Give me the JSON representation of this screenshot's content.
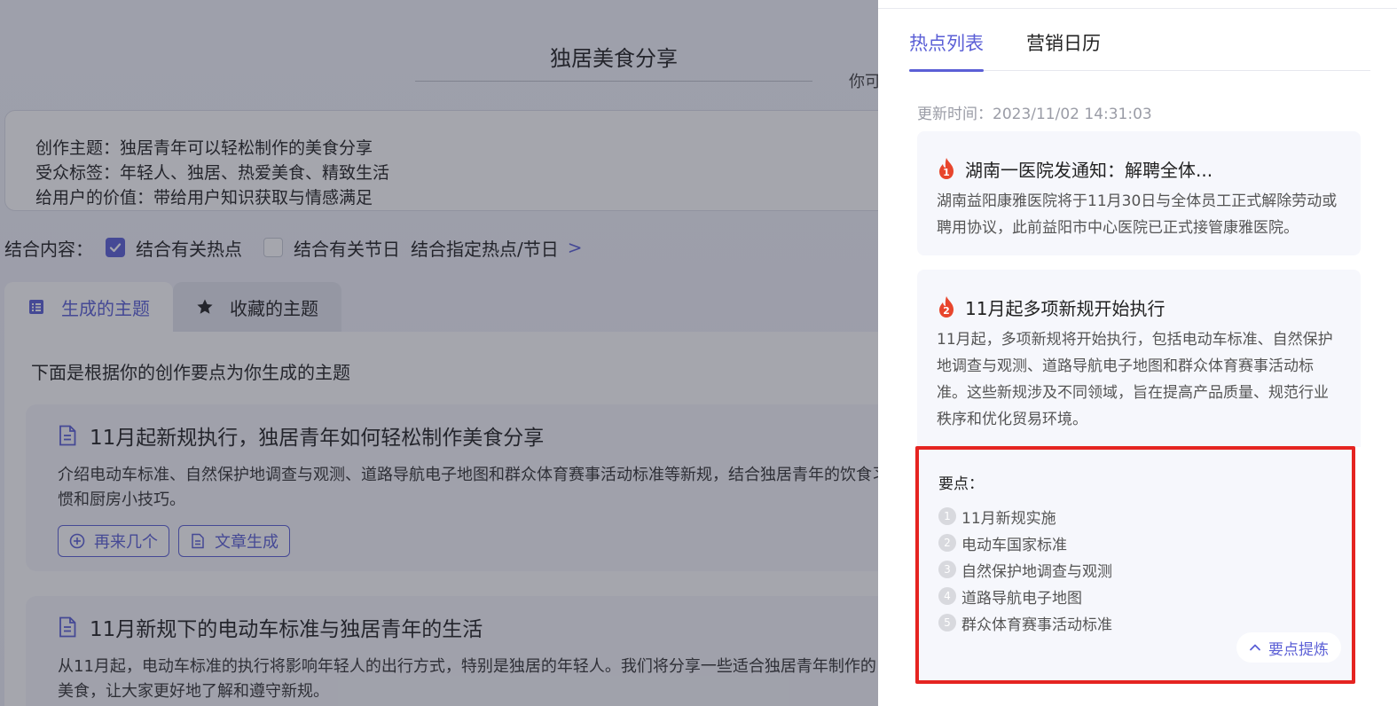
{
  "left": {
    "title_value": "独居美食分享",
    "hint_text": "你可",
    "brief": {
      "theme": "创作主题：独居青年可以轻松制作的美食分享",
      "audience": "受众标签：年轻人、独居、热爱美食、精致生活",
      "value": "给用户的价值：带给用户知识获取与情感满足"
    },
    "combine": {
      "label": "结合内容：",
      "option_hot": "结合有关热点",
      "option_holiday": "结合有关节日",
      "option_specific": "结合指定热点/节日",
      "chevron": ">"
    },
    "tabs": {
      "generated": "生成的主题",
      "favorites": "收藏的主题"
    },
    "intro": "下面是根据你的创作要点为你生成的主题",
    "cards": [
      {
        "title": "11月起新规执行，独居青年如何轻松制作美食分享",
        "desc": "介绍电动车标准、自然保护地调查与观测、道路导航电子地图和群众体育赛事活动标准等新规，结合独居青年的饮食习惯和厨房小技巧。",
        "btn_more": "再来几个",
        "btn_article": "文章生成"
      },
      {
        "title": "11月新规下的电动车标准与独居青年的生活",
        "desc": "从11月起，电动车标准的执行将影响年轻人的出行方式，特别是独居的年轻人。我们将分享一些适合独居青年制作的美食，让大家更好地了解和遵守新规。"
      }
    ]
  },
  "drawer": {
    "tabs": {
      "hot_list": "热点列表",
      "calendar": "营销日历"
    },
    "update_time": "更新时间：2023/11/02 14:31:03",
    "hot_items": [
      {
        "rank": "1",
        "title": "湖南一医院发通知：解聘全体...",
        "body": "湖南益阳康雅医院将于11月30日与全体员工正式解除劳动或聘用协议，此前益阳市中心医院已正式接管康雅医院。"
      },
      {
        "rank": "2",
        "title": "11月起多项新规开始执行",
        "body": "11月起，多项新规将开始执行，包括电动车标准、自然保护地调查与观测、道路导航电子地图和群众体育赛事活动标准。这些新规涉及不同领域，旨在提高产品质量、规范行业秩序和优化贸易环境。"
      }
    ],
    "keypoints": {
      "label": "要点：",
      "items": [
        {
          "num": "1",
          "text": "11月新规实施"
        },
        {
          "num": "2",
          "text": "电动车国家标准"
        },
        {
          "num": "3",
          "text": "自然保护地调查与观测"
        },
        {
          "num": "4",
          "text": "道路导航电子地图"
        },
        {
          "num": "5",
          "text": "群众体育赛事活动标准"
        }
      ],
      "refine_button": "要点提炼"
    }
  },
  "colors": {
    "accent": "#5b5fd6",
    "highlight_border": "#e52421",
    "fire": "#e8452c"
  }
}
